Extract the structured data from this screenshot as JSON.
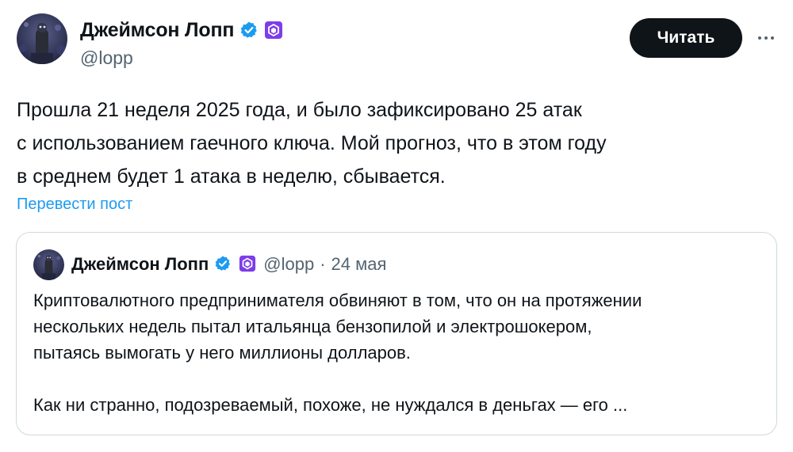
{
  "author": {
    "name": "Джеймсон Лопп",
    "handle": "@lopp"
  },
  "actions": {
    "read_label": "Читать"
  },
  "post": {
    "lines": [
      "Прошла 21 неделя 2025 года, и было зафиксировано 25 атак",
      "с использованием гаечного ключа. Мой прогноз, что в этом году",
      "в среднем будет 1 атака в неделю, сбывается."
    ],
    "translate_label": "Перевести пост"
  },
  "quote": {
    "name": "Джеймсон Лопп",
    "handle": "@lopp",
    "separator": "·",
    "date": "24 мая",
    "lines": [
      "Криптовалютного предпринимателя обвиняют в том, что он на протяжении",
      "нескольких недель пытал итальянца бензопилой и электрошокером,",
      "пытаясь вымогать у него миллионы долларов.",
      "Как ни странно, подозреваемый, похоже, не нуждался в деньгах — его ..."
    ]
  },
  "colors": {
    "verified_badge": "#1d9bf0",
    "affiliate_badge": "#7d3de8",
    "link": "#1d9bf0",
    "secondary_text": "#536471",
    "button_bg": "#0f1419"
  },
  "icons": {
    "verified": "verified-checkmark-icon",
    "affiliate": "affiliate-hexagon-icon",
    "more": "more-dots-icon"
  }
}
